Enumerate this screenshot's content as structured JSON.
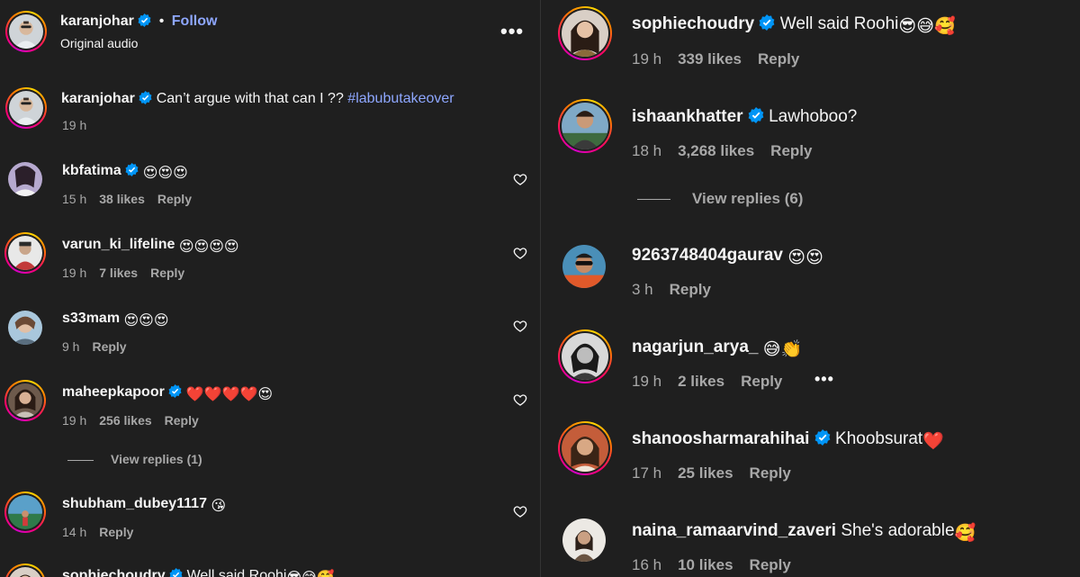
{
  "post": {
    "author": "karanjohar",
    "follow_label": "Follow",
    "dot": "•",
    "audio": "Original audio",
    "more": "•••"
  },
  "caption": {
    "user": "karanjohar",
    "text": "Can’t argue with that can I ??",
    "hashtag": "#labubutakeover",
    "time": "19 h"
  },
  "left_comments": [
    {
      "user": "kbfatima",
      "text": "",
      "emojis": "😍😍😍",
      "time": "15 h",
      "likes": "38 likes",
      "reply": "Reply"
    },
    {
      "user": "varun_ki_lifeline",
      "text": "",
      "emojis": "😍😍😍😍",
      "time": "19 h",
      "likes": "7 likes",
      "reply": "Reply"
    },
    {
      "user": "s33mam",
      "text": "",
      "emojis": "😍😍😍",
      "time": "9 h",
      "likes": "",
      "reply": "Reply"
    },
    {
      "user": "maheepkapoor",
      "text": "",
      "emojis": "❤️❤️❤️❤️😍",
      "time": "19 h",
      "likes": "256 likes",
      "reply": "Reply",
      "view_replies": "View replies (1)"
    },
    {
      "user": "shubham_dubey1117",
      "text": "",
      "emojis": "😘",
      "time": "14 h",
      "likes": "",
      "reply": "Reply"
    },
    {
      "user": "sophiechoudry",
      "text": "Well said Roohi",
      "emojis": "😎😅🥰"
    }
  ],
  "right_comments": [
    {
      "user": "sophiechoudry",
      "text": "Well said Roohi",
      "emojis": "😎😅🥰",
      "time": "19 h",
      "likes": "339 likes",
      "reply": "Reply"
    },
    {
      "user": "ishaankhatter",
      "text": "Lawhoboo?",
      "emojis": "",
      "time": "18 h",
      "likes": "3,268 likes",
      "reply": "Reply",
      "view_replies": "View replies (6)"
    },
    {
      "user": "9263748404gaurav",
      "text": "",
      "emojis": "😍😍",
      "time": "3 h",
      "likes": "",
      "reply": "Reply"
    },
    {
      "user": "nagarjun_arya_",
      "text": "",
      "emojis": "😅👏",
      "time": "19 h",
      "likes": "2 likes",
      "reply": "Reply",
      "more": "•••"
    },
    {
      "user": "shanoosharmarahihai",
      "text": "Khoobsurat",
      "emojis": "❤️",
      "time": "17 h",
      "likes": "25 likes",
      "reply": "Reply"
    },
    {
      "user": "naina_ramaarvind_zaveri",
      "text": "She's adorable",
      "emojis": "🥰",
      "time": "16 h",
      "likes": "10 likes",
      "reply": "Reply"
    }
  ],
  "colors": {
    "background": "#1f1f1f",
    "text": "#f5f5f5",
    "muted": "#a8a8a8",
    "link": "#8ea7ff",
    "verified": "#0095f6"
  },
  "icons": [
    "verified-badge-icon",
    "heart-icon",
    "more-options-icon",
    "story-ring"
  ]
}
